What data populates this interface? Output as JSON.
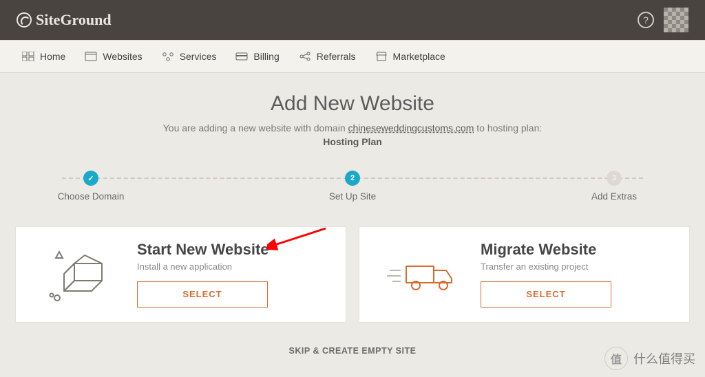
{
  "brand": "SiteGround",
  "nav": {
    "home": "Home",
    "websites": "Websites",
    "services": "Services",
    "billing": "Billing",
    "referrals": "Referrals",
    "marketplace": "Marketplace"
  },
  "page": {
    "title": "Add New Website",
    "sub_prefix": "You are adding a new website with domain ",
    "domain": "chineseweddingcustoms.com",
    "sub_suffix": " to hosting plan:",
    "plan": "Hosting Plan"
  },
  "steps": {
    "s1": {
      "label": "Choose Domain",
      "badge": "✓"
    },
    "s2": {
      "label": "Set Up Site",
      "badge": "2"
    },
    "s3": {
      "label": "Add Extras",
      "badge": "3"
    }
  },
  "cards": {
    "start": {
      "title": "Start New Website",
      "sub": "Install a new application",
      "button": "SELECT"
    },
    "migrate": {
      "title": "Migrate Website",
      "sub": "Transfer an existing project",
      "button": "SELECT"
    }
  },
  "skip": "SKIP & CREATE EMPTY SITE",
  "help_glyph": "?",
  "watermark": {
    "badge": "值",
    "text": "什么值得买"
  }
}
